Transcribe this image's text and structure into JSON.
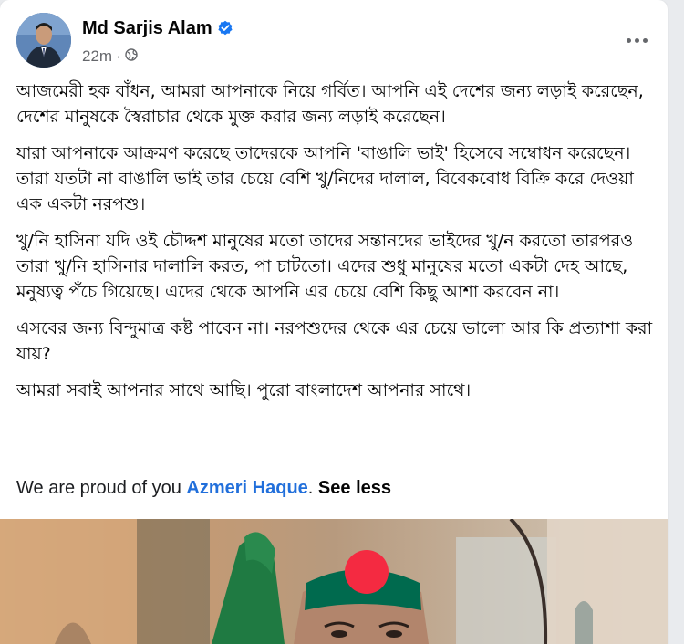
{
  "post": {
    "author": "Md Sarjis Alam",
    "time": "22m",
    "paragraphs": [
      "আজমেরী হক বাঁধন, আমরা আপনাকে নিয়ে গর্বিত। আপনি এই দেশের জন্য লড়াই করেছেন, দেশের মানুষকে স্বৈরাচার থেকে মুক্ত করার জন্য লড়াই করেছেন।",
      "যারা আপনাকে আক্রমণ করেছে তাদেরকে আপনি 'বাঙালি ভাই' হিসেবে সম্বোধন করেছেন। তারা যতটা না বাঙালি ভাই তার চেয়ে বেশি খু/নিদের দালাল, বিবেকবোধ বিক্রি করে দেওয়া এক একটা নরপশু।",
      "খু/নি হাসিনা যদি ওই চৌদ্দশ মানুষের মতো তাদের সন্তানদের ভাইদের খু/ন করতো তারপরও তারা খু/নি হাসিনার দালালি করত, পা চাটতো। এদের শুধু মানুষের মতো একটা দেহ আছে, মনুষ্যত্ব পঁচে গিয়েছে। এদের থেকে আপনি এর চেয়ে বেশি কিছু আশা করবেন না।",
      "এসবের জন্য বিন্দুমাত্র কষ্ট পাবেন না। নরপশুদের থেকে এর চেয়ে ভালো আর কি প্রত্যাশা করা যায়?",
      "আমরা সবাই আপনার সাথে আছি। পুরো বাংলাদেশ আপনার সাথে।"
    ],
    "english_prefix": "We are proud of you",
    "mention": "Azmeri Haque",
    "period": ".",
    "see_less": "See less"
  },
  "icons": {
    "verified": "verified-badge-icon",
    "audience": "globe-icon",
    "more": "more-options-icon"
  },
  "colors": {
    "name": "#050505",
    "meta": "#65676b",
    "mention": "#216fdb",
    "verified": "#1877f2",
    "flag_green": "#006a4e",
    "flag_red": "#f42a41"
  }
}
